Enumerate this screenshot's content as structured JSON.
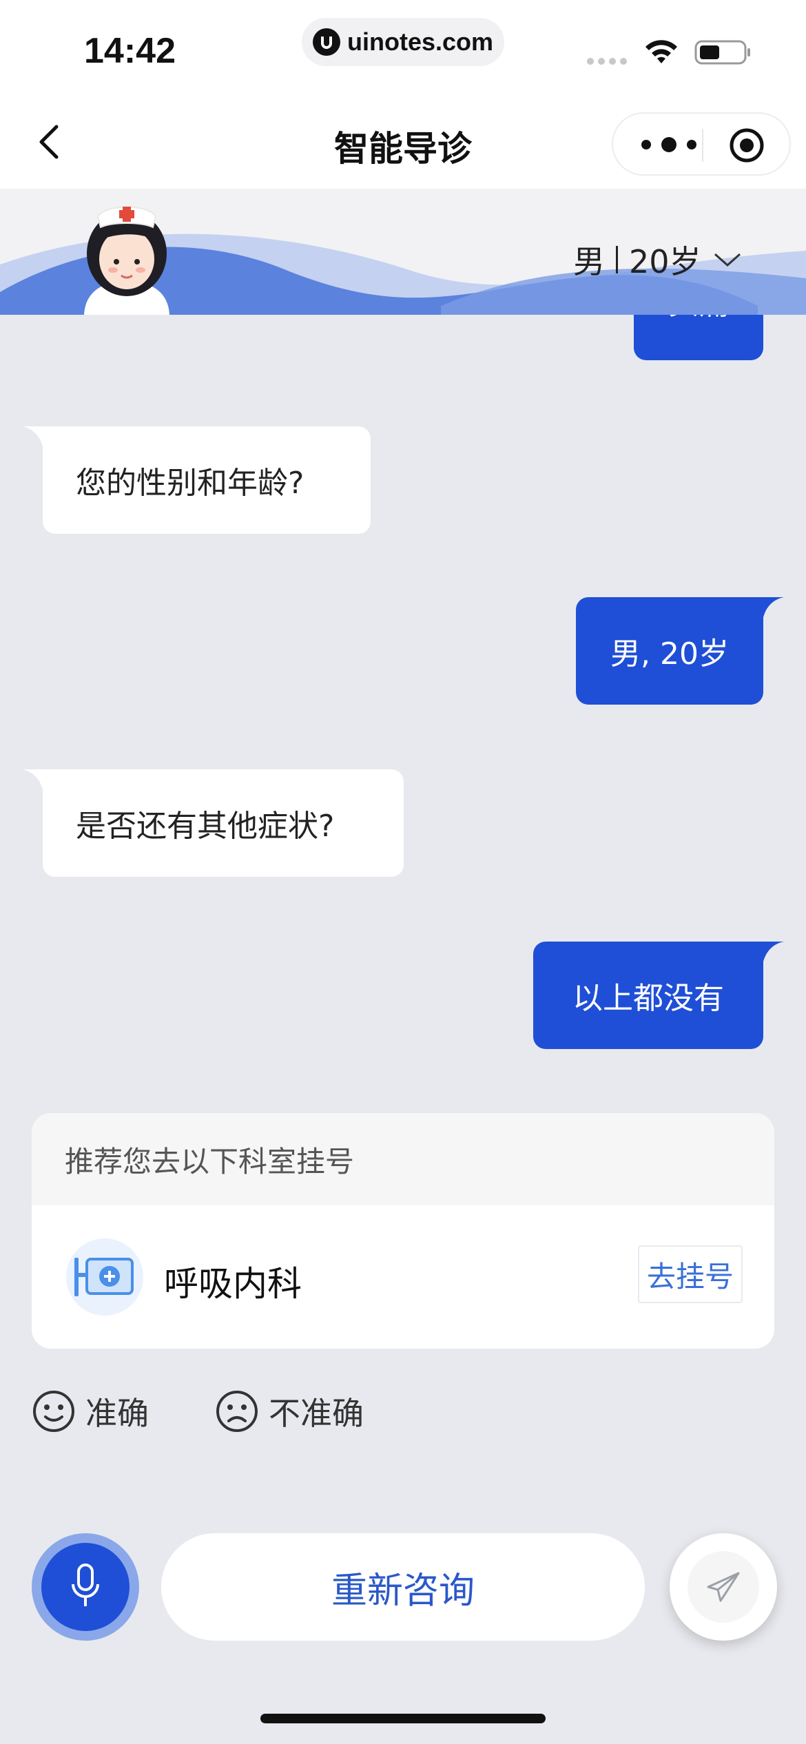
{
  "status_bar": {
    "time": "14:42",
    "url": "uinotes.com"
  },
  "nav": {
    "title": "智能导诊"
  },
  "banner": {
    "gender": "男",
    "age": "20岁"
  },
  "chat": {
    "messages": [
      {
        "from": "user",
        "text": "头痛"
      },
      {
        "from": "bot",
        "text": "您的性别和年龄?"
      },
      {
        "from": "user",
        "text": "男, 20岁"
      },
      {
        "from": "bot",
        "text": "是否还有其他症状?"
      },
      {
        "from": "user",
        "text": "以上都没有"
      }
    ]
  },
  "recommendation": {
    "header": "推荐您去以下科室挂号",
    "department": "呼吸内科",
    "register_label": "去挂号"
  },
  "feedback": {
    "accurate_label": "准确",
    "inaccurate_label": "不准确"
  },
  "bottom": {
    "restart_label": "重新咨询"
  },
  "colors": {
    "accent": "#1f4fd6",
    "background": "#e8e9ee",
    "link": "#3a6fd8"
  }
}
